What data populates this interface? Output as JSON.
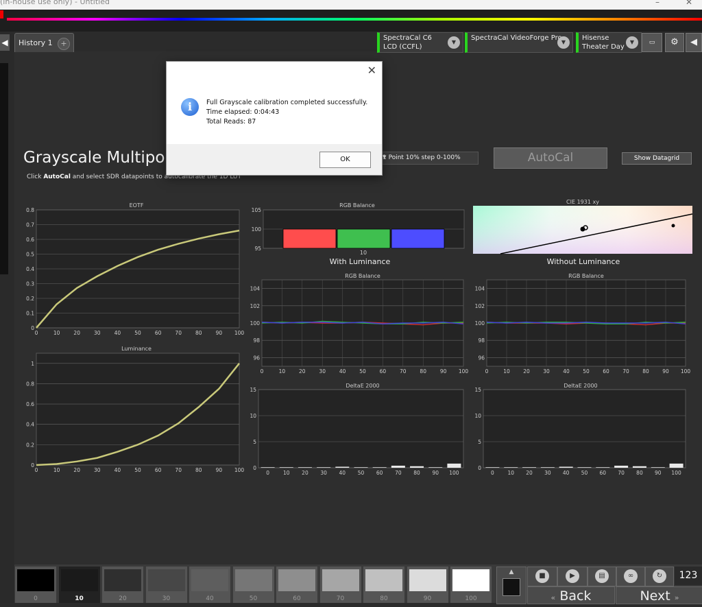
{
  "window": {
    "title": "(in-house use only) - Untitled",
    "minimize": "–",
    "close": "✕"
  },
  "nav": {
    "left_arrow": "◀",
    "right_arrow": "◀"
  },
  "tabs": [
    {
      "label": "History 1"
    },
    {
      "label": "+"
    }
  ],
  "devices": [
    {
      "line1": "SpectraCal C6",
      "line2": "LCD (CCFL)"
    },
    {
      "line1": "SpectraCal VideoForge Pro",
      "line2": ""
    },
    {
      "line1": "Hisense",
      "line2": "Theater Day"
    }
  ],
  "page": {
    "heading": "Grayscale Multipoint",
    "instruction_pre": "Click ",
    "instruction_bold": "AutoCal",
    "instruction_post": " and select SDR datapoints to autocalibrate the 1D LUT",
    "instruction_tail": "1D LUT",
    "preset": "1 Point 10% step 0-100%",
    "autocal": "AutoCal",
    "show_datagrid": "Show Datagrid"
  },
  "dialog": {
    "line1": "Full Grayscale calibration completed successfully.",
    "line2": "Time elapsed: 0:04:43",
    "line3": "Total Reads: 87",
    "ok": "OK"
  },
  "section_labels": {
    "with_lum": "With Luminance",
    "without_lum": "Without Luminance"
  },
  "chart_data": [
    {
      "id": "eotf",
      "type": "line",
      "title": "EOTF",
      "x": [
        0,
        10,
        20,
        30,
        40,
        50,
        60,
        70,
        80,
        90,
        100
      ],
      "values": [
        0,
        0.16,
        0.27,
        0.35,
        0.42,
        0.48,
        0.53,
        0.57,
        0.605,
        0.635,
        0.66
      ],
      "xlim": [
        0,
        100
      ],
      "ylim": [
        0,
        0.8
      ],
      "yticks": [
        0,
        0.1,
        0.2,
        0.3,
        0.4,
        0.5,
        0.6,
        0.7,
        0.8
      ],
      "xticks": [
        0,
        10,
        20,
        30,
        40,
        50,
        60,
        70,
        80,
        90,
        100
      ]
    },
    {
      "id": "luminance",
      "type": "line",
      "title": "Luminance",
      "x": [
        0,
        10,
        20,
        30,
        40,
        50,
        60,
        70,
        80,
        90,
        100
      ],
      "values": [
        0,
        0.01,
        0.035,
        0.07,
        0.13,
        0.2,
        0.29,
        0.41,
        0.57,
        0.75,
        1.0
      ],
      "xlim": [
        0,
        100
      ],
      "ylim": [
        0,
        1.1
      ],
      "yticks": [
        0,
        0.2,
        0.4,
        0.6,
        0.8,
        1
      ],
      "xticks": [
        0,
        10,
        20,
        30,
        40,
        50,
        60,
        70,
        80,
        90,
        100
      ]
    },
    {
      "id": "rgb_top",
      "type": "bar",
      "title": "RGB Balance",
      "categories": [
        "10"
      ],
      "series": [
        {
          "name": "R",
          "color": "#ff4d4d",
          "value": 100
        },
        {
          "name": "G",
          "color": "#3fbf4f",
          "value": 100
        },
        {
          "name": "B",
          "color": "#4d4dff",
          "value": 100
        }
      ],
      "ylim": [
        95,
        105
      ],
      "yticks": [
        95,
        100,
        105
      ]
    },
    {
      "id": "cie",
      "type": "scatter",
      "title": "CIE 1931 xy"
    },
    {
      "id": "rgb_with",
      "type": "line",
      "title": "RGB Balance",
      "x": [
        0,
        10,
        20,
        30,
        40,
        50,
        60,
        70,
        80,
        90,
        100
      ],
      "series": [
        {
          "color": "#d03030",
          "values": [
            100.1,
            100.0,
            100.1,
            100.0,
            100.0,
            100.1,
            100.0,
            99.9,
            99.8,
            100.0,
            100.0
          ]
        },
        {
          "color": "#30b040",
          "values": [
            100.0,
            100.1,
            100.0,
            100.2,
            100.1,
            100.0,
            99.9,
            99.9,
            100.1,
            100.0,
            100.1
          ]
        },
        {
          "color": "#4040d8",
          "values": [
            100.1,
            100.0,
            100.1,
            100.1,
            100.0,
            100.1,
            99.9,
            100.0,
            100.0,
            100.1,
            99.9
          ]
        }
      ],
      "ylim": [
        95,
        105
      ],
      "yticks": [
        96,
        98,
        100,
        102,
        104
      ],
      "xticks": [
        0,
        10,
        20,
        30,
        40,
        50,
        60,
        70,
        80,
        90,
        100
      ]
    },
    {
      "id": "rgb_without",
      "type": "line",
      "title": "RGB Balance",
      "x": [
        0,
        10,
        20,
        30,
        40,
        50,
        60,
        70,
        80,
        90,
        100
      ],
      "series": [
        {
          "color": "#d03030",
          "values": [
            100.1,
            100.0,
            100.0,
            100.0,
            99.9,
            100.0,
            100.0,
            99.9,
            99.8,
            100.0,
            100.0
          ]
        },
        {
          "color": "#30b040",
          "values": [
            100.0,
            100.1,
            100.0,
            100.1,
            100.1,
            100.0,
            99.9,
            99.9,
            100.1,
            100.0,
            100.1
          ]
        },
        {
          "color": "#4040d8",
          "values": [
            100.1,
            100.0,
            100.1,
            100.0,
            100.0,
            100.1,
            100.0,
            100.0,
            100.0,
            100.1,
            99.9
          ]
        }
      ],
      "ylim": [
        95,
        105
      ],
      "yticks": [
        96,
        98,
        100,
        102,
        104
      ],
      "xticks": [
        0,
        10,
        20,
        30,
        40,
        50,
        60,
        70,
        80,
        90,
        100
      ]
    },
    {
      "id": "de_with",
      "type": "bar",
      "title": "DeltaE 2000",
      "categories": [
        "0",
        "10",
        "20",
        "30",
        "40",
        "50",
        "60",
        "70",
        "80",
        "90",
        "100"
      ],
      "values": [
        0.1,
        0.1,
        0.1,
        0.1,
        0.2,
        0.1,
        0.1,
        0.4,
        0.3,
        0.1,
        0.8
      ],
      "ylim": [
        0,
        15
      ],
      "yticks": [
        0,
        5,
        10,
        15
      ]
    },
    {
      "id": "de_without",
      "type": "bar",
      "title": "DeltaE 2000",
      "categories": [
        "0",
        "10",
        "20",
        "30",
        "40",
        "50",
        "60",
        "70",
        "80",
        "90",
        "100"
      ],
      "values": [
        0.1,
        0.1,
        0.1,
        0.1,
        0.2,
        0.1,
        0.1,
        0.4,
        0.3,
        0.1,
        0.8
      ],
      "ylim": [
        0,
        15
      ],
      "yticks": [
        0,
        5,
        10,
        15
      ]
    }
  ],
  "swatches": [
    {
      "label": "0",
      "color": "#000000"
    },
    {
      "label": "10",
      "color": "#1a1a1a"
    },
    {
      "label": "20",
      "color": "#2f2f2f"
    },
    {
      "label": "30",
      "color": "#474747"
    },
    {
      "label": "40",
      "color": "#5e5e5e"
    },
    {
      "label": "50",
      "color": "#767676"
    },
    {
      "label": "60",
      "color": "#8e8e8e"
    },
    {
      "label": "70",
      "color": "#a6a6a6"
    },
    {
      "label": "80",
      "color": "#c0c0c0"
    },
    {
      "label": "90",
      "color": "#dcdcdc"
    },
    {
      "label": "100",
      "color": "#ffffff"
    }
  ],
  "controls": {
    "back": "Back",
    "next": "Next",
    "counter": "123"
  }
}
